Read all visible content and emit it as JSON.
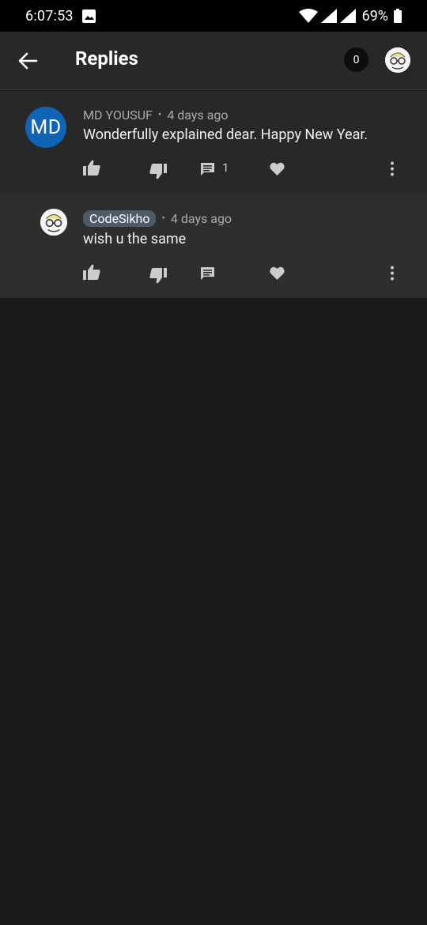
{
  "status_bar": {
    "time": "6:07:53",
    "battery": "69%"
  },
  "header": {
    "title": "Replies",
    "notification_count": "0"
  },
  "top_comment": {
    "avatar_initials": "MD",
    "author": "MD YOUSUF",
    "separator": "•",
    "time": "4 days ago",
    "text": "Wonderfully explained dear. Happy New Year.",
    "reply_count": "1"
  },
  "reply": {
    "author": "CodeSikho",
    "separator": "•",
    "time": "4 days ago",
    "text": "wish u the same"
  },
  "colors": {
    "background": "#1a1a1a",
    "header": "#282828",
    "avatar_blue": "#0f64b8",
    "author_chip": "#4d5a68"
  },
  "icons": [
    "back-arrow-icon",
    "wifi-icon",
    "signal-icon",
    "battery-icon",
    "gallery-icon",
    "like-icon",
    "dislike-icon",
    "reply-icon",
    "heart-icon",
    "more-vert-icon"
  ]
}
